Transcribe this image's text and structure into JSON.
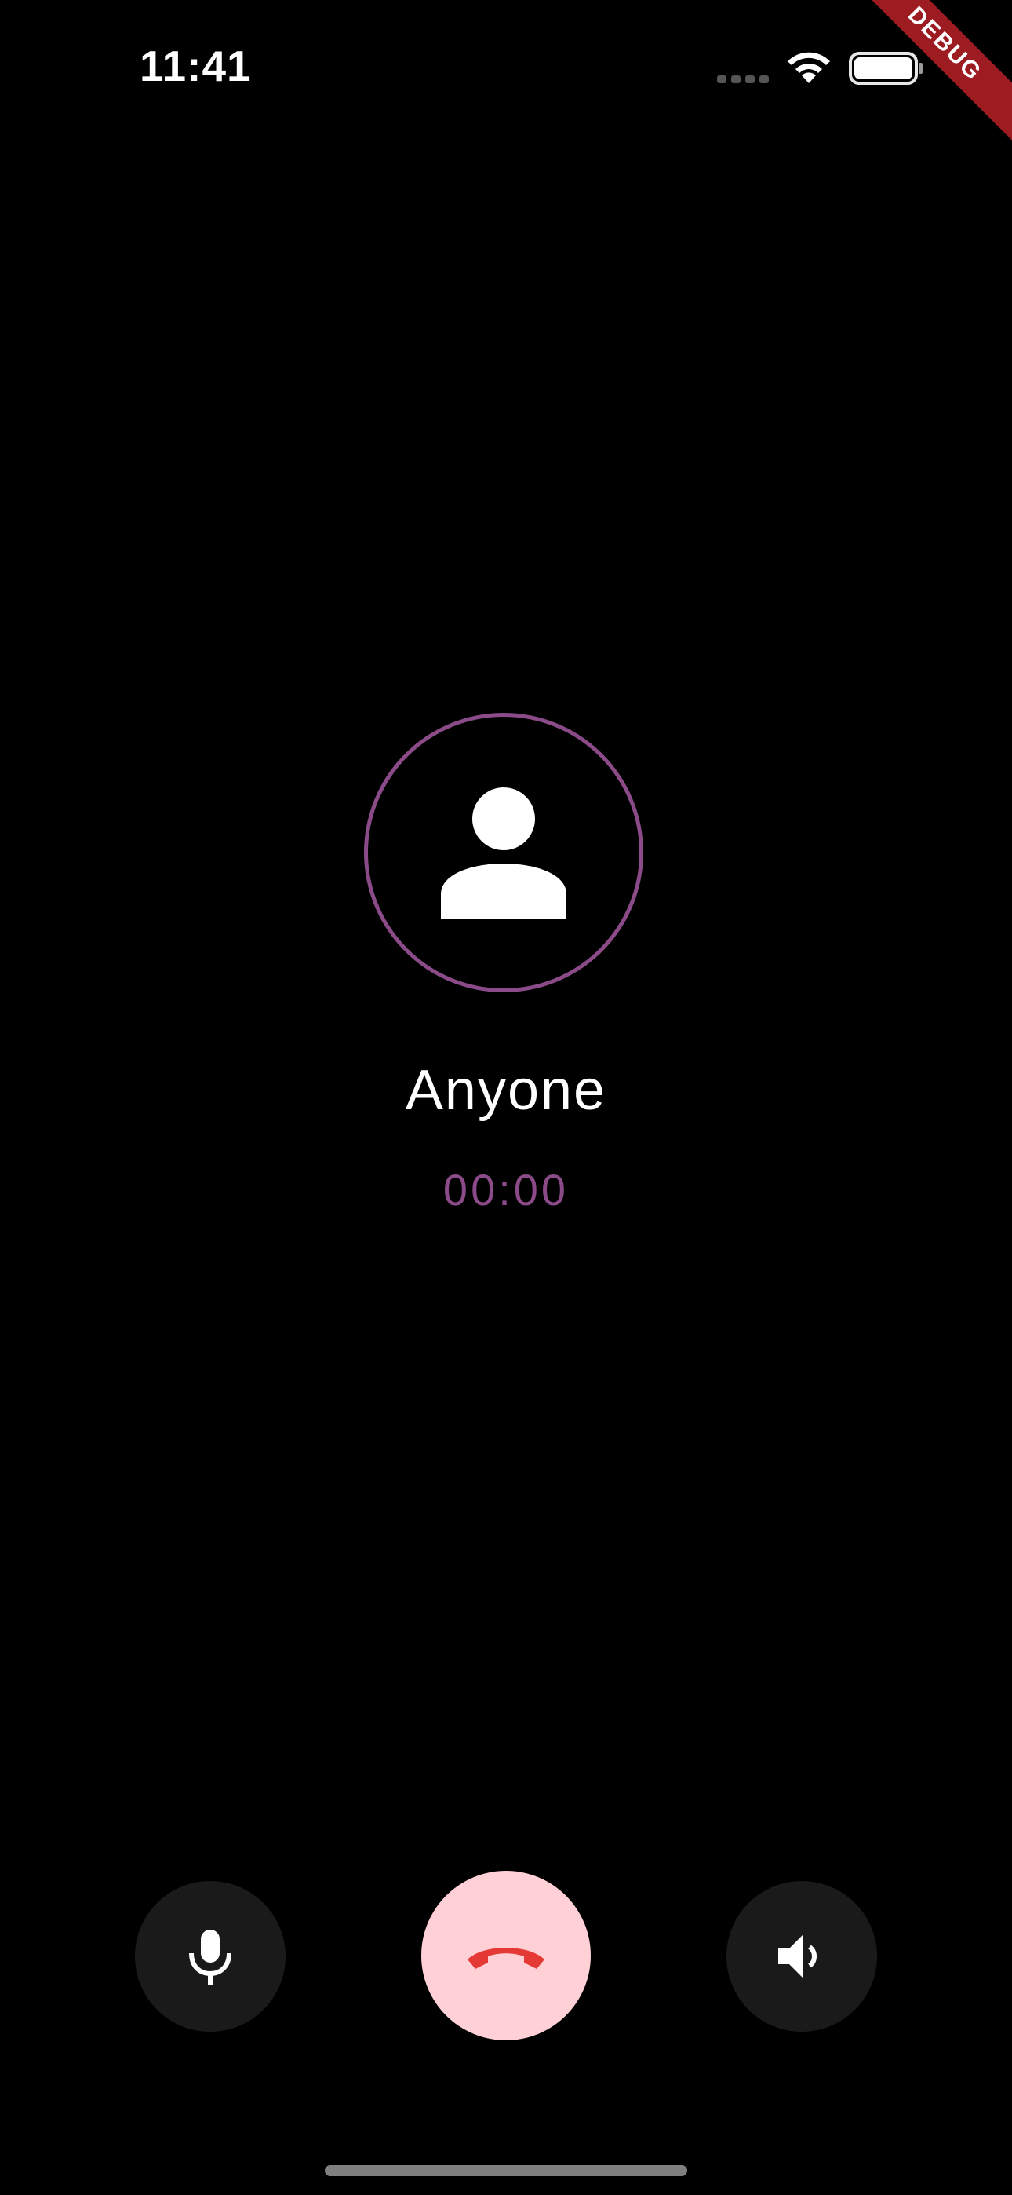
{
  "status_bar": {
    "time": "11:41",
    "icons": [
      "cellular-signal-icon",
      "wifi-icon",
      "battery-icon"
    ]
  },
  "debug_banner": {
    "label": "DEBUG",
    "color": "#9c1c22"
  },
  "caller": {
    "avatar_icon": "person-icon",
    "name": "Anyone",
    "timer": "00:00"
  },
  "controls": {
    "mute": {
      "icon": "microphone-icon"
    },
    "end_call": {
      "icon": "call-end-icon"
    },
    "speaker": {
      "icon": "speaker-icon"
    }
  },
  "colors": {
    "background": "#000000",
    "accent": "#8b4b88",
    "end_call_bg": "#ffd1d6",
    "end_call_icon": "#e53935",
    "control_bg": "#1a1a1a"
  }
}
